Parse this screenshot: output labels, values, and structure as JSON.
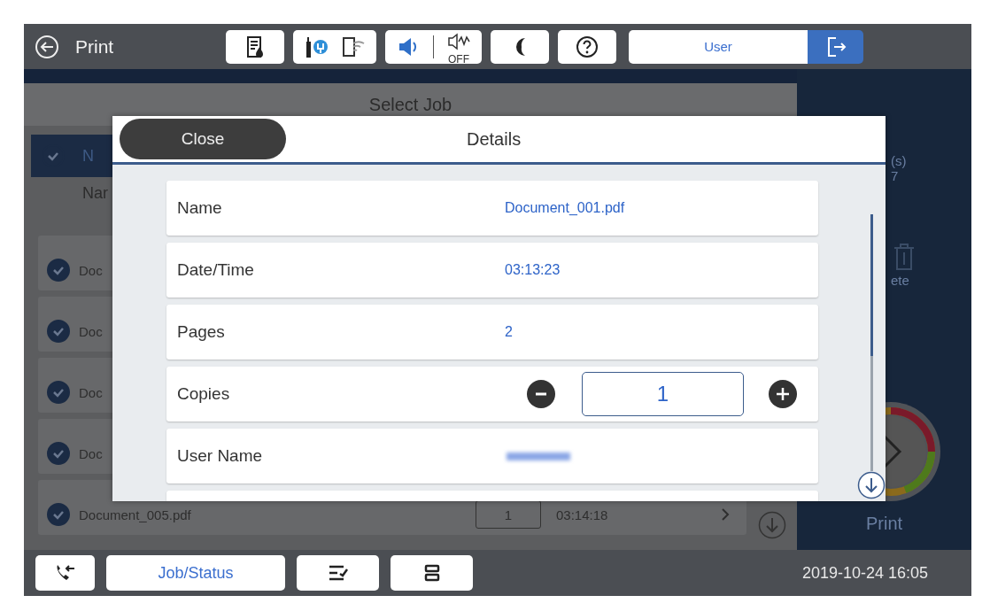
{
  "top_bar": {
    "title": "Print",
    "status_buttons": [
      {
        "kind": "ink"
      },
      {
        "kind": "connection"
      },
      {
        "kind": "sound",
        "off_label": "OFF"
      },
      {
        "kind": "sleep"
      },
      {
        "kind": "help"
      }
    ],
    "user_button": "User"
  },
  "background": {
    "header": "Select Job",
    "selected_row": "N",
    "column_header": "Nar",
    "jobs": [
      {
        "name": "Doc",
        "checked": true
      },
      {
        "name": "Doc",
        "checked": true
      },
      {
        "name": "Doc",
        "checked": true
      },
      {
        "name": "Doc",
        "checked": true
      },
      {
        "name": "Document_005.pdf",
        "checked": true,
        "copies": "1",
        "time": "03:14:18"
      }
    ],
    "side_panel": {
      "count_label": "(s)",
      "count": "7",
      "delete_label": "ete",
      "print_label": "Print"
    }
  },
  "dialog": {
    "close": "Close",
    "title": "Details",
    "fields": [
      {
        "kind": "text",
        "label": "Name",
        "value": "Document_001.pdf"
      },
      {
        "kind": "text",
        "label": "Date/Time",
        "value": "03:13:23"
      },
      {
        "kind": "text",
        "label": "Pages",
        "value": "2"
      },
      {
        "kind": "stepper",
        "label": "Copies",
        "value": "1"
      },
      {
        "kind": "blurred",
        "label": "User Name"
      }
    ]
  },
  "bottom_bar": {
    "buttons": [
      {
        "kind": "phone"
      },
      {
        "kind": "text",
        "label": "Job/Status"
      },
      {
        "kind": "queue"
      },
      {
        "kind": "stack"
      }
    ],
    "datetime": "2019-10-24 16:05"
  }
}
